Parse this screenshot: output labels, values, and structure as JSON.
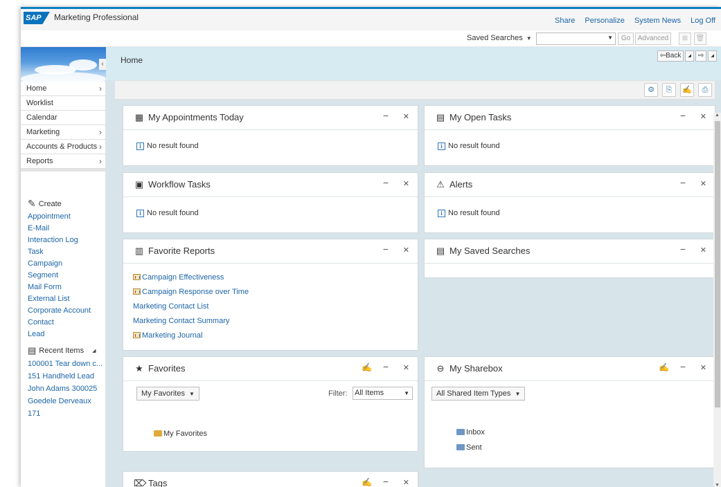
{
  "header": {
    "logo": "SAP",
    "app_title": "Marketing Professional",
    "links": [
      "Share",
      "Personalize",
      "System News",
      "Log Off"
    ]
  },
  "search": {
    "saved_searches_label": "Saved Searches",
    "go_label": "Go",
    "advanced_label": "Advanced"
  },
  "sidebar": {
    "nav": [
      {
        "label": "Home",
        "has_arrow": true
      },
      {
        "label": "Worklist",
        "has_arrow": false
      },
      {
        "label": "Calendar",
        "has_arrow": false
      },
      {
        "label": "Marketing",
        "has_arrow": true
      },
      {
        "label": "Accounts & Products",
        "has_arrow": true
      },
      {
        "label": "Reports",
        "has_arrow": true
      }
    ],
    "create_title": "Create",
    "create_items": [
      "Appointment",
      "E-Mail",
      "Interaction Log",
      "Task",
      "Campaign",
      "Segment",
      "Mail Form",
      "External List",
      "Corporate Account",
      "Contact",
      "Lead"
    ],
    "recent_title": "Recent Items",
    "recent_items": [
      "100001 Tear down c...",
      "151 Handheld Lead",
      "John Adams 300025",
      "Goedele Derveaux",
      "171"
    ]
  },
  "main": {
    "page_title": "Home",
    "back_label": "Back",
    "panels": {
      "appointments": {
        "title": "My Appointments Today",
        "message": "No result found"
      },
      "open_tasks": {
        "title": "My Open Tasks",
        "message": "No result found"
      },
      "workflow": {
        "title": "Workflow Tasks",
        "message": "No result found"
      },
      "alerts": {
        "title": "Alerts",
        "message": "No result found"
      },
      "favorite_reports": {
        "title": "Favorite Reports",
        "reports": [
          {
            "label": "Campaign Effectiveness",
            "icon": true
          },
          {
            "label": "Campaign Response over Time",
            "icon": true
          },
          {
            "label": "Marketing Contact List",
            "icon": false
          },
          {
            "label": "Marketing Contact Summary",
            "icon": false
          },
          {
            "label": "Marketing Journal",
            "icon": true
          }
        ]
      },
      "saved_searches": {
        "title": "My Saved Searches"
      },
      "favorites": {
        "title": "Favorites",
        "dropdown": "My Favorites",
        "filter_label": "Filter:",
        "filter_value": "All Items",
        "folder": "My Favorites"
      },
      "sharebox": {
        "title": "My Sharebox",
        "dropdown": "All Shared Item Types",
        "folders": [
          "Inbox",
          "Sent"
        ]
      },
      "tags": {
        "title": "Tags"
      }
    }
  }
}
